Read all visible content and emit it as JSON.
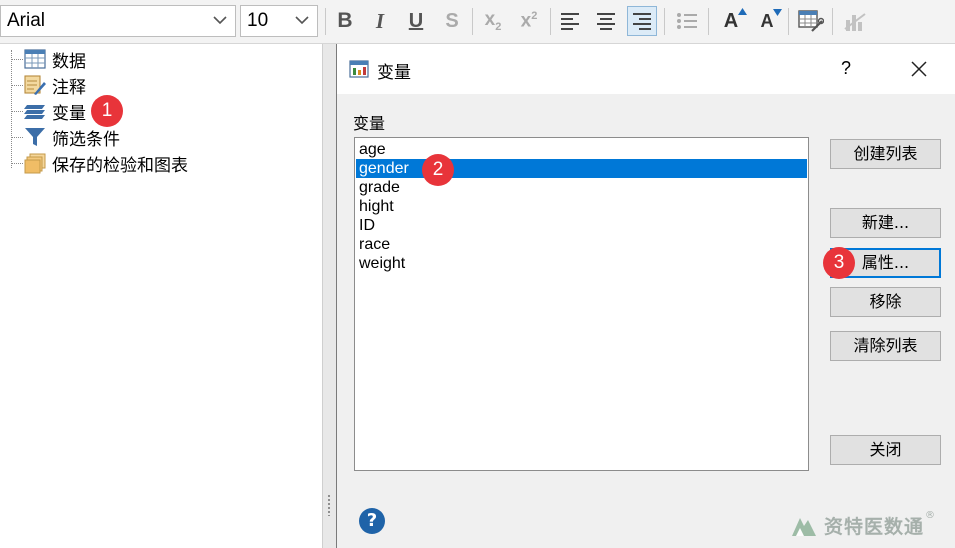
{
  "toolbar": {
    "font_name": "Arial",
    "font_size": "10",
    "bold_label": "B",
    "italic_label": "I",
    "underline_label": "U",
    "strike_label": "S",
    "subscript_label": "x",
    "subscript_sub": "2",
    "superscript_label": "x",
    "superscript_sup": "2",
    "grow_font_label": "A",
    "shrink_font_label": "A"
  },
  "tree": {
    "items": [
      {
        "label": "数据",
        "icon": "table-icon"
      },
      {
        "label": "注释",
        "icon": "note-pencil-icon"
      },
      {
        "label": "变量",
        "icon": "stack-layers-icon"
      },
      {
        "label": "筛选条件",
        "icon": "funnel-icon"
      },
      {
        "label": "保存的检验和图表",
        "icon": "folder-stack-icon"
      }
    ]
  },
  "dialog": {
    "title": "变量",
    "help_button": "?",
    "list_label": "变量",
    "variables": [
      "age",
      "gender",
      "grade",
      "hight",
      "ID",
      "race",
      "weight"
    ],
    "selected_index": 1,
    "buttons": {
      "create_list": "创建列表",
      "new": "新建...",
      "properties": "属性...",
      "remove": "移除",
      "clear_list": "清除列表",
      "close": "关闭"
    },
    "help_icon": "?"
  },
  "annotations": [
    "1",
    "2",
    "3"
  ],
  "watermark": {
    "text": "资特医数通",
    "mark": "®"
  },
  "colors": {
    "selection": "#0078d7",
    "badge": "#e8343a",
    "focus_border": "#0078d7",
    "help_blue": "#1f63a8"
  }
}
